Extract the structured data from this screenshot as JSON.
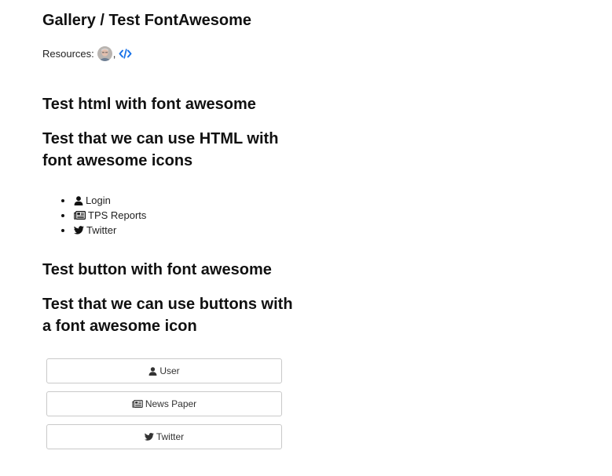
{
  "header": {
    "title": "Gallery / Test FontAwesome",
    "resources_label": "Resources:",
    "separator": ","
  },
  "sections": {
    "html_test": {
      "heading": "Test html with font awesome",
      "subheading": "Test that we can use HTML with font awesome icons"
    },
    "button_test": {
      "heading": "Test button with font awesome",
      "subheading": "Test that we can use buttons with a font awesome icon"
    }
  },
  "list_items": [
    {
      "icon": "user-icon",
      "label": "Login"
    },
    {
      "icon": "newspaper-icon",
      "label": "TPS Reports"
    },
    {
      "icon": "twitter-icon",
      "label": "Twitter"
    }
  ],
  "buttons": [
    {
      "icon": "user-icon",
      "label": "User"
    },
    {
      "icon": "newspaper-icon",
      "label": "News Paper"
    },
    {
      "icon": "twitter-icon",
      "label": "Twitter"
    }
  ],
  "colors": {
    "link_blue": "#1a73e8",
    "text": "#111111",
    "button_border": "#c9c9c9"
  }
}
